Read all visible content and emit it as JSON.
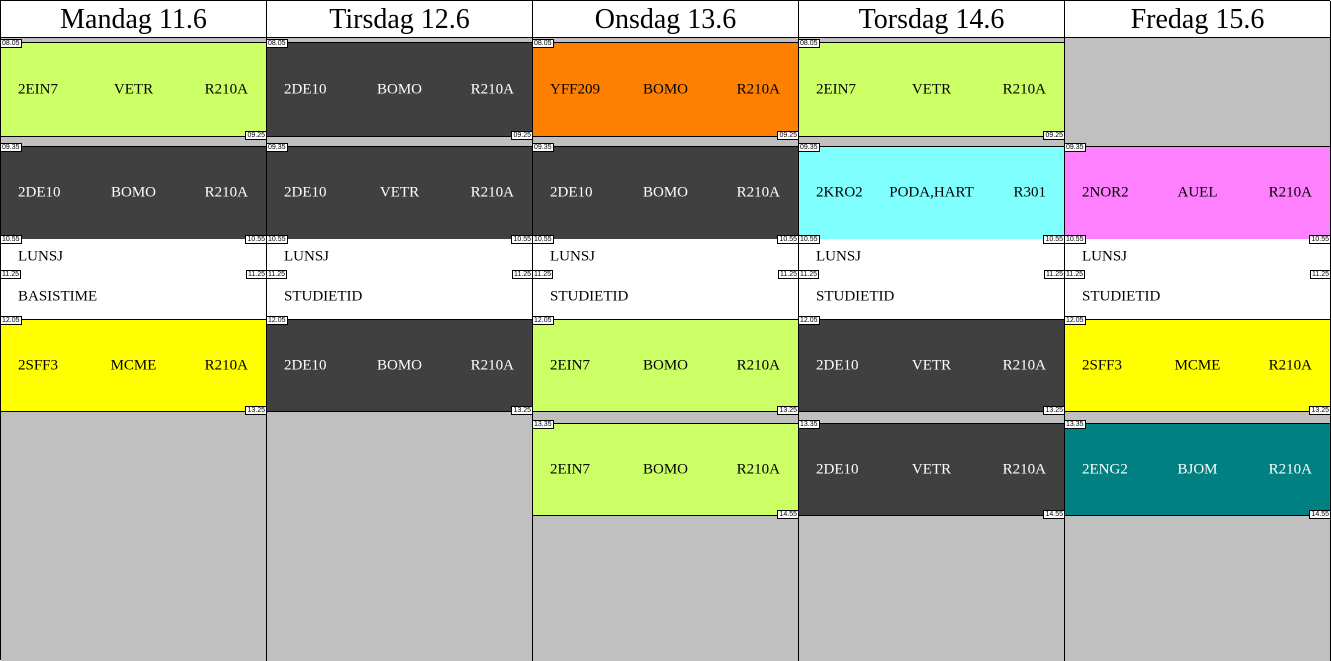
{
  "days": [
    {
      "label": "Mandag 11.6"
    },
    {
      "label": "Tirsdag 12.6"
    },
    {
      "label": "Onsdag 13.6"
    },
    {
      "label": "Torsdag 14.6"
    },
    {
      "label": "Fredag 15.6"
    }
  ],
  "times": {
    "t0805": "08.05",
    "t0925": "09.25",
    "t0935": "09.35",
    "t1055": "10.55",
    "t1125": "11.25",
    "t1205": "12.05",
    "t1325": "13.25",
    "t1335": "13.35",
    "t1455": "14.55"
  },
  "lessons": {
    "mon": [
      {
        "code": "2EIN7",
        "teacher": "VETR",
        "room": "R210A",
        "color": "lime"
      },
      {
        "code": "2DE10",
        "teacher": "BOMO",
        "room": "R210A",
        "color": "dark"
      },
      {
        "code": "2SFF3",
        "teacher": "MCME",
        "room": "R210A",
        "color": "yellow"
      }
    ],
    "tue": [
      {
        "code": "2DE10",
        "teacher": "BOMO",
        "room": "R210A",
        "color": "dark"
      },
      {
        "code": "2DE10",
        "teacher": "VETR",
        "room": "R210A",
        "color": "dark"
      },
      {
        "code": "2DE10",
        "teacher": "BOMO",
        "room": "R210A",
        "color": "dark"
      }
    ],
    "wed": [
      {
        "code": "YFF209",
        "teacher": "BOMO",
        "room": "R210A",
        "color": "orange"
      },
      {
        "code": "2DE10",
        "teacher": "BOMO",
        "room": "R210A",
        "color": "dark"
      },
      {
        "code": "2EIN7",
        "teacher": "BOMO",
        "room": "R210A",
        "color": "lime"
      },
      {
        "code": "2EIN7",
        "teacher": "BOMO",
        "room": "R210A",
        "color": "lime"
      }
    ],
    "thu": [
      {
        "code": "2EIN7",
        "teacher": "VETR",
        "room": "R210A",
        "color": "lime"
      },
      {
        "code": "2KRO2",
        "teacher": "PODA,HART",
        "room": "R301",
        "color": "cyan"
      },
      {
        "code": "2DE10",
        "teacher": "VETR",
        "room": "R210A",
        "color": "dark"
      },
      {
        "code": "2DE10",
        "teacher": "VETR",
        "room": "R210A",
        "color": "dark"
      }
    ],
    "fri": [
      {
        "code": "2NOR2",
        "teacher": "AUEL",
        "room": "R210A",
        "color": "pink"
      },
      {
        "code": "2SFF3",
        "teacher": "MCME",
        "room": "R210A",
        "color": "yellow"
      },
      {
        "code": "2ENG2",
        "teacher": "BJOM",
        "room": "R210A",
        "color": "teal"
      }
    ]
  },
  "breaks": {
    "lunch": "LUNSJ",
    "mon_after": "BASISTIME",
    "other_after": "STUDIETID"
  },
  "colors": {
    "lime": "#ccff66",
    "dark": "#404040",
    "orange": "#ff8000",
    "cyan": "#80ffff",
    "pink": "#ff80ff",
    "yellow": "#ffff00",
    "teal": "#008080",
    "empty": "#c0c0c0"
  }
}
